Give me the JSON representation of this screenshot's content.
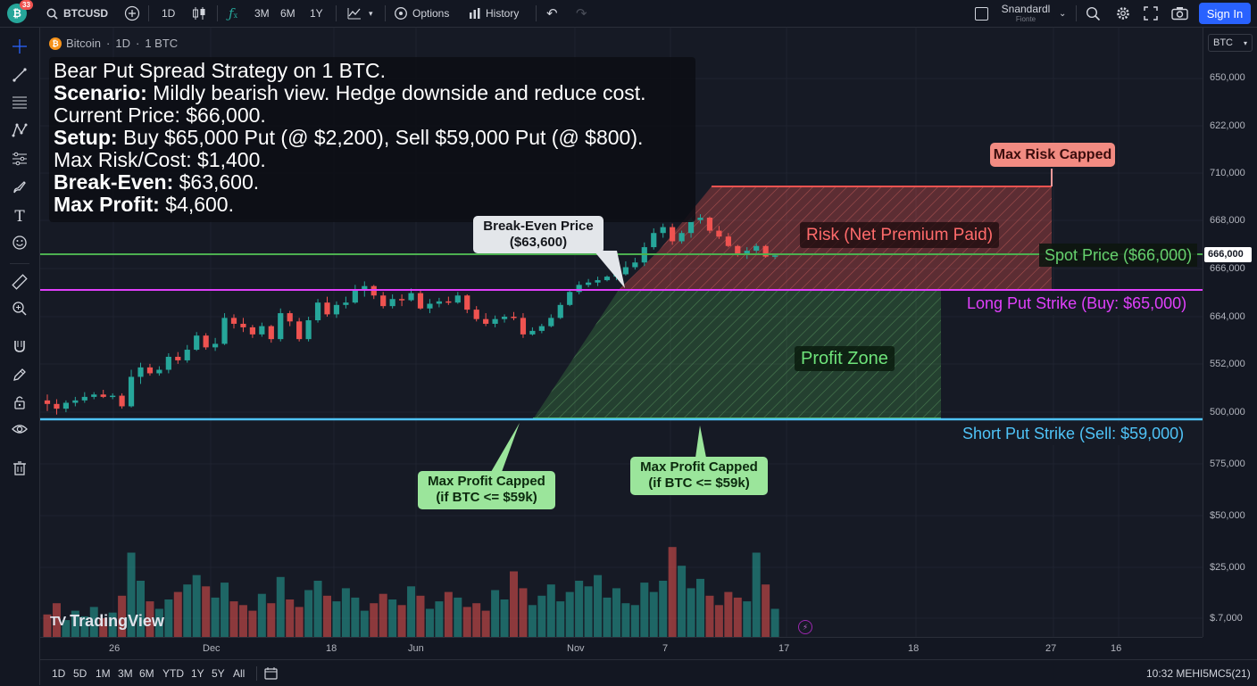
{
  "topbar": {
    "notification_count": "33",
    "symbol": "BTCUSD",
    "interval": "1D",
    "ranges": [
      "3M",
      "6M",
      "1Y"
    ],
    "options_label": "Options",
    "history_label": "History",
    "layout_name": "Snandardl",
    "layout_sub": "Fionte",
    "sign_in_label": "Sign In"
  },
  "legend": {
    "coin_glyph": "₿",
    "name": "Bitcoin",
    "dot1": "·",
    "interval": "1D",
    "dot2": "·",
    "qty": "1 BTC"
  },
  "info_panel": {
    "line1": "Bear Put Spread Strategy on 1 BTC.",
    "line2_key": "Scenario:",
    "line2_val": " Mildly bearish view. Hedge downside and reduce cost.",
    "line3": "Current Price: $66,000.",
    "line4_key": "Setup:",
    "line4_val": " Buy $65,000 Put (@ $2,200), Sell $59,000 Put (@ $800).",
    "line5": "Max Risk/Cost: $1,400.",
    "line6_key": "Break-Even:",
    "line6_val": " $63,600.",
    "line7_key": "Max Profit:",
    "line7_val": " $4,600."
  },
  "annotations": {
    "max_risk_capped": "Max Risk Capped",
    "risk_zone": "Risk (Net Premium Paid)",
    "spot_price": "Spot Price ($66,000)",
    "long_put": "Long Put Strike (Buy: $65,000)",
    "profit_zone": "Profit Zone",
    "short_put": "Short Put Strike (Sell: $59,000)",
    "break_even_line1": "Break-Even Price",
    "break_even_line2": "($63,600)",
    "max_profit_a_line1": "Max Profit Capped",
    "max_profit_a_line2": "(if BTC <= $59k)",
    "max_profit_b_line1": "Max Profit Capped",
    "max_profit_b_line2": "(if BTC <= $59k)"
  },
  "colors": {
    "up": "#26a69a",
    "down": "#ef5350",
    "spot_line": "#4caf50",
    "long_put_line": "#e040fb",
    "short_put_line": "#4fc3f7",
    "risk_zone": "#ef5350",
    "profit_zone": "#4caf50",
    "accent": "#2962ff"
  },
  "price_scale": {
    "currency": "BTC",
    "labels": [
      "650,000",
      "622,000",
      "710,000",
      "668,000",
      "666,000",
      "664,000",
      "552,000",
      "500,000",
      "575,000",
      "$50,000",
      "$25,000",
      "$.7,000"
    ],
    "current_price_label": "666,000"
  },
  "time_scale": {
    "labels": [
      "26",
      "Dec",
      "18",
      "Jun",
      "Nov",
      "7",
      "17",
      "18",
      "27",
      "16"
    ]
  },
  "bottombar": {
    "ranges": [
      "1D",
      "5D",
      "1M",
      "3M",
      "6M",
      "YTD",
      "1Y",
      "5Y",
      "All"
    ],
    "clock": "10:32 MEHI5MC5(21)"
  },
  "watermark": {
    "logo_text": "TV",
    "brand": "TradingView"
  },
  "chart_data": {
    "type": "candlestick",
    "title": "",
    "candles": [
      {
        "o": 59800,
        "h": 60050,
        "l": 59350,
        "c": 59650
      },
      {
        "o": 59650,
        "h": 59850,
        "l": 59200,
        "c": 59450
      },
      {
        "o": 59450,
        "h": 59800,
        "l": 59300,
        "c": 59700
      },
      {
        "o": 59700,
        "h": 59950,
        "l": 59550,
        "c": 59800
      },
      {
        "o": 59800,
        "h": 60150,
        "l": 59700,
        "c": 59950
      },
      {
        "o": 59950,
        "h": 60150,
        "l": 59850,
        "c": 60050
      },
      {
        "o": 60050,
        "h": 60250,
        "l": 59900,
        "c": 59950
      },
      {
        "o": 59950,
        "h": 60100,
        "l": 59850,
        "c": 60000
      },
      {
        "o": 60000,
        "h": 60100,
        "l": 59450,
        "c": 59550
      },
      {
        "o": 59550,
        "h": 61100,
        "l": 59500,
        "c": 60800
      },
      {
        "o": 60800,
        "h": 61400,
        "l": 60500,
        "c": 61200
      },
      {
        "o": 61200,
        "h": 61350,
        "l": 60850,
        "c": 60950
      },
      {
        "o": 60950,
        "h": 61250,
        "l": 60850,
        "c": 61100
      },
      {
        "o": 61100,
        "h": 61800,
        "l": 60950,
        "c": 61650
      },
      {
        "o": 61650,
        "h": 61850,
        "l": 61350,
        "c": 61500
      },
      {
        "o": 61500,
        "h": 62150,
        "l": 61400,
        "c": 61950
      },
      {
        "o": 61950,
        "h": 62700,
        "l": 61900,
        "c": 62550
      },
      {
        "o": 62550,
        "h": 62650,
        "l": 61950,
        "c": 62050
      },
      {
        "o": 62050,
        "h": 62450,
        "l": 61900,
        "c": 62200
      },
      {
        "o": 62200,
        "h": 63500,
        "l": 62150,
        "c": 63300
      },
      {
        "o": 63300,
        "h": 63450,
        "l": 62850,
        "c": 63050
      },
      {
        "o": 63050,
        "h": 63300,
        "l": 62700,
        "c": 62900
      },
      {
        "o": 62900,
        "h": 63000,
        "l": 62450,
        "c": 62600
      },
      {
        "o": 62600,
        "h": 63100,
        "l": 62500,
        "c": 62950
      },
      {
        "o": 62950,
        "h": 63000,
        "l": 62250,
        "c": 62400
      },
      {
        "o": 62400,
        "h": 63700,
        "l": 62300,
        "c": 63500
      },
      {
        "o": 63500,
        "h": 63600,
        "l": 62950,
        "c": 63150
      },
      {
        "o": 63150,
        "h": 63300,
        "l": 62300,
        "c": 62400
      },
      {
        "o": 62400,
        "h": 63350,
        "l": 62300,
        "c": 63200
      },
      {
        "o": 63200,
        "h": 64100,
        "l": 63100,
        "c": 63950
      },
      {
        "o": 63950,
        "h": 64200,
        "l": 63350,
        "c": 63450
      },
      {
        "o": 63450,
        "h": 64000,
        "l": 63300,
        "c": 63850
      },
      {
        "o": 63850,
        "h": 64200,
        "l": 63700,
        "c": 63950
      },
      {
        "o": 63950,
        "h": 64700,
        "l": 63900,
        "c": 64450
      },
      {
        "o": 64450,
        "h": 64850,
        "l": 64200,
        "c": 64650
      },
      {
        "o": 64650,
        "h": 64700,
        "l": 64100,
        "c": 64250
      },
      {
        "o": 64250,
        "h": 64400,
        "l": 63700,
        "c": 63800
      },
      {
        "o": 63800,
        "h": 64300,
        "l": 63700,
        "c": 64100
      },
      {
        "o": 64100,
        "h": 64300,
        "l": 63800,
        "c": 64050
      },
      {
        "o": 64050,
        "h": 64550,
        "l": 64000,
        "c": 64350
      },
      {
        "o": 64350,
        "h": 64450,
        "l": 63650,
        "c": 63700
      },
      {
        "o": 63700,
        "h": 64100,
        "l": 63500,
        "c": 63900
      },
      {
        "o": 63900,
        "h": 64150,
        "l": 63750,
        "c": 64000
      },
      {
        "o": 64000,
        "h": 64200,
        "l": 63850,
        "c": 63950
      },
      {
        "o": 63950,
        "h": 64400,
        "l": 63900,
        "c": 64250
      },
      {
        "o": 64250,
        "h": 64300,
        "l": 63500,
        "c": 63650
      },
      {
        "o": 63650,
        "h": 63800,
        "l": 63150,
        "c": 63250
      },
      {
        "o": 63250,
        "h": 63500,
        "l": 62950,
        "c": 63050
      },
      {
        "o": 63050,
        "h": 63400,
        "l": 62900,
        "c": 63250
      },
      {
        "o": 63250,
        "h": 63450,
        "l": 63100,
        "c": 63350
      },
      {
        "o": 63350,
        "h": 63550,
        "l": 63200,
        "c": 63300
      },
      {
        "o": 63300,
        "h": 63500,
        "l": 62450,
        "c": 62600
      },
      {
        "o": 62600,
        "h": 62900,
        "l": 62550,
        "c": 62750
      },
      {
        "o": 62750,
        "h": 63050,
        "l": 62650,
        "c": 62950
      },
      {
        "o": 62950,
        "h": 63450,
        "l": 62900,
        "c": 63300
      },
      {
        "o": 63300,
        "h": 63950,
        "l": 63250,
        "c": 63850
      },
      {
        "o": 63850,
        "h": 64500,
        "l": 63800,
        "c": 64400
      },
      {
        "o": 64400,
        "h": 64850,
        "l": 64300,
        "c": 64700
      },
      {
        "o": 64700,
        "h": 64950,
        "l": 64600,
        "c": 64800
      },
      {
        "o": 64800,
        "h": 65050,
        "l": 64650,
        "c": 64900
      },
      {
        "o": 64900,
        "h": 65100,
        "l": 64850,
        "c": 65050
      },
      {
        "o": 65050,
        "h": 65200,
        "l": 64900,
        "c": 65150
      },
      {
        "o": 65150,
        "h": 65700,
        "l": 65100,
        "c": 65450
      },
      {
        "o": 65450,
        "h": 65850,
        "l": 65350,
        "c": 65650
      },
      {
        "o": 65650,
        "h": 66500,
        "l": 65500,
        "c": 66300
      },
      {
        "o": 66300,
        "h": 67100,
        "l": 66200,
        "c": 66900
      },
      {
        "o": 66900,
        "h": 67300,
        "l": 66700,
        "c": 67150
      },
      {
        "o": 67150,
        "h": 67300,
        "l": 66400,
        "c": 66550
      },
      {
        "o": 66550,
        "h": 67000,
        "l": 66450,
        "c": 66900
      },
      {
        "o": 66900,
        "h": 67550,
        "l": 66700,
        "c": 67450
      },
      {
        "o": 67450,
        "h": 67700,
        "l": 67300,
        "c": 67550
      },
      {
        "o": 67550,
        "h": 67600,
        "l": 66900,
        "c": 67000
      },
      {
        "o": 67000,
        "h": 67200,
        "l": 66650,
        "c": 66750
      },
      {
        "o": 66750,
        "h": 66900,
        "l": 66300,
        "c": 66350
      },
      {
        "o": 66350,
        "h": 66400,
        "l": 65900,
        "c": 66000
      },
      {
        "o": 66000,
        "h": 66300,
        "l": 65800,
        "c": 66150
      },
      {
        "o": 66150,
        "h": 66450,
        "l": 66050,
        "c": 66350
      },
      {
        "o": 66350,
        "h": 66400,
        "l": 65850,
        "c": 65900
      },
      {
        "o": 65900,
        "h": 66000,
        "l": 65800,
        "c": 65950
      }
    ],
    "volume": [
      12,
      18,
      9,
      14,
      11,
      16,
      10,
      13,
      22,
      45,
      30,
      19,
      15,
      20,
      24,
      28,
      33,
      27,
      21,
      29,
      19,
      17,
      14,
      23,
      18,
      32,
      20,
      16,
      25,
      30,
      22,
      19,
      26,
      21,
      14,
      18,
      23,
      20,
      17,
      27,
      22,
      15,
      19,
      24,
      21,
      16,
      18,
      14,
      25,
      20,
      35,
      26,
      17,
      22,
      28,
      19,
      24,
      30,
      27,
      33,
      21,
      26,
      18,
      17,
      29,
      24,
      30,
      48,
      38,
      26,
      31,
      22,
      17,
      24,
      21,
      19,
      45,
      28,
      15
    ],
    "levels": {
      "spot_price": 66000,
      "long_put_strike": 65000,
      "break_even": 63600,
      "short_put_strike": 59000,
      "max_risk_cap": 67400
    }
  }
}
